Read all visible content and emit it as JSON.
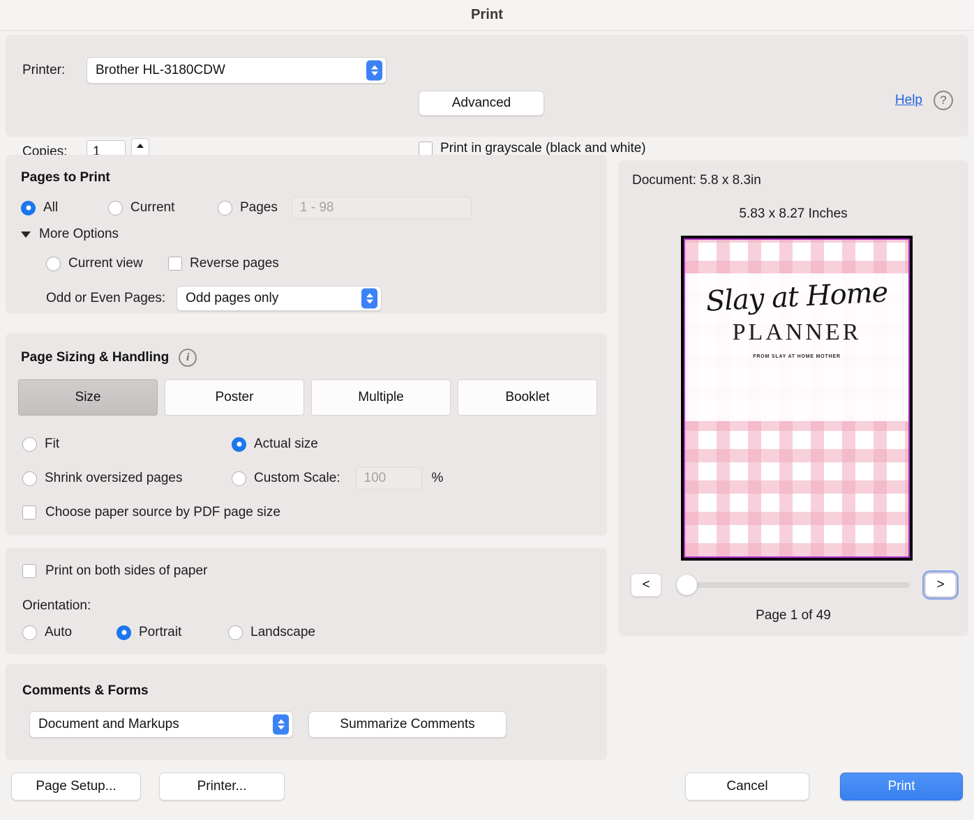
{
  "window": {
    "title": "Print"
  },
  "printer_bar": {
    "printer_label": "Printer:",
    "printer_value": "Brother HL-3180CDW",
    "advanced_label": "Advanced",
    "help_label": "Help",
    "help_icon_glyph": "?",
    "copies_label": "Copies:",
    "copies_value": "1",
    "grayscale_label": "Print in grayscale (black and white)"
  },
  "pages_to_print": {
    "title": "Pages to Print",
    "all_label": "All",
    "current_label": "Current",
    "pages_label": "Pages",
    "pages_range_placeholder": "1 - 98",
    "more_options_label": "More Options",
    "current_view_label": "Current view",
    "reverse_pages_label": "Reverse pages",
    "odd_even_label": "Odd or Even Pages:",
    "odd_even_value": "Odd pages only"
  },
  "page_sizing": {
    "title": "Page Sizing & Handling",
    "info_glyph": "i",
    "tabs": [
      {
        "label": "Size",
        "active": true
      },
      {
        "label": "Poster",
        "active": false
      },
      {
        "label": "Multiple",
        "active": false
      },
      {
        "label": "Booklet",
        "active": false
      }
    ],
    "fit_label": "Fit",
    "actual_size_label": "Actual size",
    "shrink_label": "Shrink oversized pages",
    "custom_scale_label": "Custom Scale:",
    "custom_scale_placeholder": "100",
    "percent_label": "%",
    "paper_source_label": "Choose paper source by PDF page size"
  },
  "sides": {
    "both_sides_label": "Print on both sides of paper",
    "orientation_label": "Orientation:",
    "auto_label": "Auto",
    "portrait_label": "Portrait",
    "landscape_label": "Landscape"
  },
  "comments": {
    "title": "Comments & Forms",
    "selected_value": "Document and Markups",
    "summarize_label": "Summarize Comments"
  },
  "preview": {
    "document_size": "Document: 5.8 x 8.3in",
    "page_size": "5.83 x 8.27 Inches",
    "page_counter": "Page 1 of 49",
    "prev_glyph": "<",
    "next_glyph": ">",
    "cover": {
      "script_title": "Slay at Home",
      "serif_title": "PLANNER",
      "subtitle": "FROM SLAY AT HOME MOTHER"
    }
  },
  "footer": {
    "page_setup_label": "Page Setup...",
    "printer_label": "Printer...",
    "cancel_label": "Cancel",
    "print_label": "Print"
  },
  "colors": {
    "accent_blue": "#3b82f6",
    "radio_selected": "#1a77ef",
    "print_button": "#3a80f0",
    "link_blue": "#2563df",
    "panel_bg": "#ebe7e7",
    "dialog_bg": "#f4f1f1"
  }
}
